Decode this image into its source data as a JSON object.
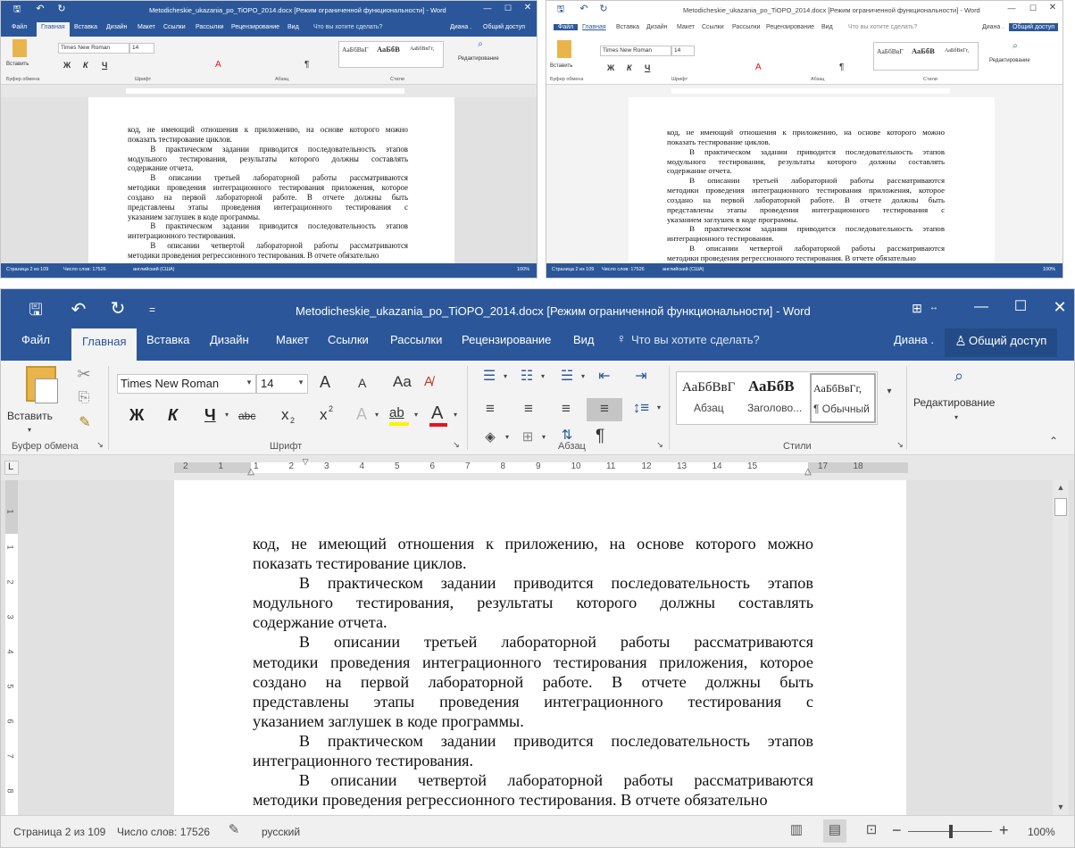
{
  "window": {
    "title": "Metodicheskie_ukazania_po_TiOPO_2014.docx [Режим ограниченной функциональности] - Word",
    "user": "Диана .",
    "share": "Общий доступ",
    "qat_dropdown": "="
  },
  "menu": {
    "file": "Файл",
    "tabs": [
      "Главная",
      "Вставка",
      "Дизайн",
      "Макет",
      "Ссылки",
      "Рассылки",
      "Рецензирование",
      "Вид"
    ],
    "tell_me": "Что вы хотите сделать?"
  },
  "ribbon": {
    "clipboard": {
      "paste": "Вставить",
      "group": "Буфер обмена"
    },
    "font": {
      "family": "Times New Roman",
      "size": "14",
      "case": "Aa",
      "bold": "Ж",
      "italic": "К",
      "underline": "Ч",
      "strike": "abc",
      "subscript": "x",
      "superscript": "x",
      "sub_mark": "2",
      "super_mark": "2",
      "effects": "A",
      "highlight": "ab",
      "color": "A",
      "grow": "A",
      "shrink": "A",
      "group": "Шрифт"
    },
    "paragraph": {
      "group": "Абзац",
      "pilcrow": "¶"
    },
    "styles": {
      "items": [
        {
          "sample": "АаБбВвГ",
          "name": "Абзац"
        },
        {
          "sample": "АаБбВ",
          "name": "Заголово..."
        },
        {
          "sample": "АаБбВвГг,",
          "name": "¶ Обычный"
        }
      ],
      "group": "Стили"
    },
    "editing": {
      "label": "Редактирование",
      "group": ""
    }
  },
  "ruler": {
    "marks": [
      "2",
      "1",
      "1",
      "2",
      "3",
      "4",
      "5",
      "6",
      "7",
      "8",
      "9",
      "10",
      "11",
      "12",
      "13",
      "14",
      "15",
      "17",
      "18"
    ],
    "vertical_marks": [
      "1",
      "1",
      "2",
      "3",
      "4",
      "5",
      "6",
      "7",
      "8"
    ],
    "corner": "L"
  },
  "document": {
    "paragraphs": [
      {
        "indent": false,
        "lines": [
          "код, не имеющий отношения к приложению, на основе которого можно",
          "показать тестирование циклов."
        ]
      },
      {
        "indent": true,
        "lines": [
          "В практическом задании приводится последовательность этапов",
          "модульного тестирования, результаты которого должны составлять",
          "содержание отчета."
        ]
      },
      {
        "indent": true,
        "lines": [
          "В описании третьей лабораторной работы рассматриваются",
          "методики проведения интеграционного тестирования приложения, которое",
          "создано на первой лабораторной работе. В отчете должны быть",
          "представлены этапы проведения интеграционного тестирования с",
          "указанием заглушек в коде программы."
        ]
      },
      {
        "indent": true,
        "lines": [
          "В практическом задании приводится последовательность этапов",
          "интеграционного тестирования."
        ]
      },
      {
        "indent": true,
        "lines": [
          "В описании четвертой лабораторной работы рассматриваются",
          "методики проведения регрессионного тестирования. В отчете обязательно"
        ]
      }
    ]
  },
  "status": {
    "page": "Страница 2 из 109",
    "words": "Число слов: 17526",
    "language": "русский",
    "language_small": "английский (США)",
    "zoom": "100%",
    "zoom_minus": "−",
    "zoom_plus": "+"
  },
  "colors": {
    "accent": "#2b579a",
    "ribbon_bg": "#f3f3f3",
    "doc_bg": "#e1e1e1",
    "font_red": "#e81123",
    "highlight_yellow": "#fff100"
  }
}
